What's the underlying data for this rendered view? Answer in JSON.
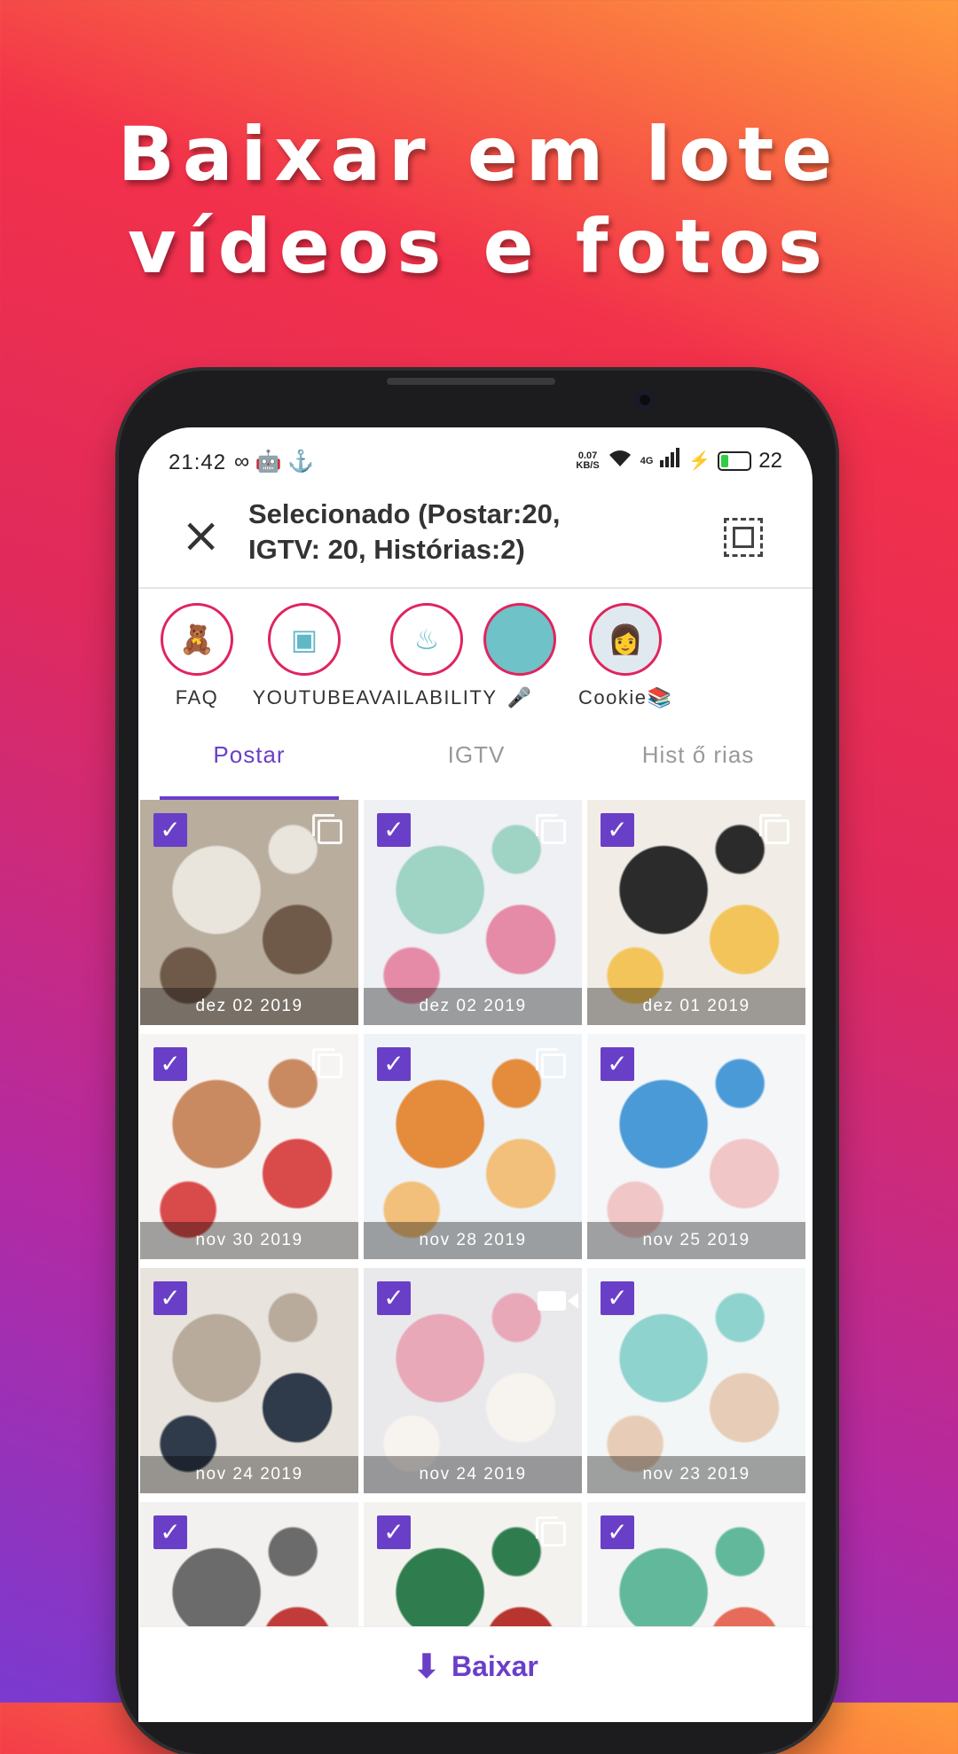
{
  "promo": {
    "line1": "Baixar em lote",
    "line2": "vídeos e fotos"
  },
  "status_bar": {
    "time": "21:42",
    "left_icons": "∞ 🤖 ⚓",
    "speed_value": "0.07",
    "speed_unit": "KB/S",
    "network": "4G",
    "battery": "22"
  },
  "header": {
    "title": "Selecionado (Postar:20, IGTV: 20, Histórias:2)"
  },
  "highlights": [
    {
      "label": "FAQ",
      "icon": "🧸"
    },
    {
      "label": "YOUTUBE",
      "icon": "▣"
    },
    {
      "label": "AVAILABILITY",
      "icon": "♨"
    },
    {
      "label": "🎤",
      "icon": ""
    },
    {
      "label": "Cookie📚",
      "icon": "👩"
    }
  ],
  "tabs": [
    {
      "label": "Postar"
    },
    {
      "label": "IGTV"
    },
    {
      "label": "Hist ő rias"
    }
  ],
  "grid": [
    {
      "date": "dez 02 2019",
      "type": "multi",
      "colors": [
        "#b9ad9e",
        "#e9e4dc",
        "#6f5a4a"
      ]
    },
    {
      "date": "dez 02 2019",
      "type": "multi",
      "colors": [
        "#eef0f3",
        "#9fd3c4",
        "#e58aa7"
      ]
    },
    {
      "date": "dez 01 2019",
      "type": "multi",
      "colors": [
        "#f1ede6",
        "#2b2b2b",
        "#f3c45a"
      ]
    },
    {
      "date": "nov 30 2019",
      "type": "multi",
      "colors": [
        "#f6f4f2",
        "#c98a62",
        "#d94a4a"
      ]
    },
    {
      "date": "nov 28 2019",
      "type": "multi",
      "colors": [
        "#eef3f7",
        "#e48b3c",
        "#f2c07a"
      ]
    },
    {
      "date": "nov 25 2019",
      "type": "single",
      "colors": [
        "#f4f6f8",
        "#4a9ad8",
        "#f0c6c6"
      ]
    },
    {
      "date": "nov 24 2019",
      "type": "single",
      "colors": [
        "#e8e3dc",
        "#b8ab9c",
        "#2f3a4a"
      ]
    },
    {
      "date": "nov 24 2019",
      "type": "video",
      "colors": [
        "#e9e9ec",
        "#e8a8b8",
        "#f7f3ee"
      ]
    },
    {
      "date": "nov 23 2019",
      "type": "single",
      "colors": [
        "#f3f6f6",
        "#8fd3cf",
        "#e7cdb7"
      ]
    },
    {
      "date": "",
      "type": "single",
      "colors": [
        "#f3f1ef",
        "#6b6b6b",
        "#c23b3b"
      ]
    },
    {
      "date": "",
      "type": "multi",
      "colors": [
        "#f4f2ef",
        "#2f7d4f",
        "#b8352f"
      ]
    },
    {
      "date": "",
      "type": "single",
      "colors": [
        "#f5f5f5",
        "#62b89a",
        "#e76b5a"
      ]
    }
  ],
  "bottom": {
    "download_label": "Baixar"
  },
  "accent": "#6a3fc8"
}
